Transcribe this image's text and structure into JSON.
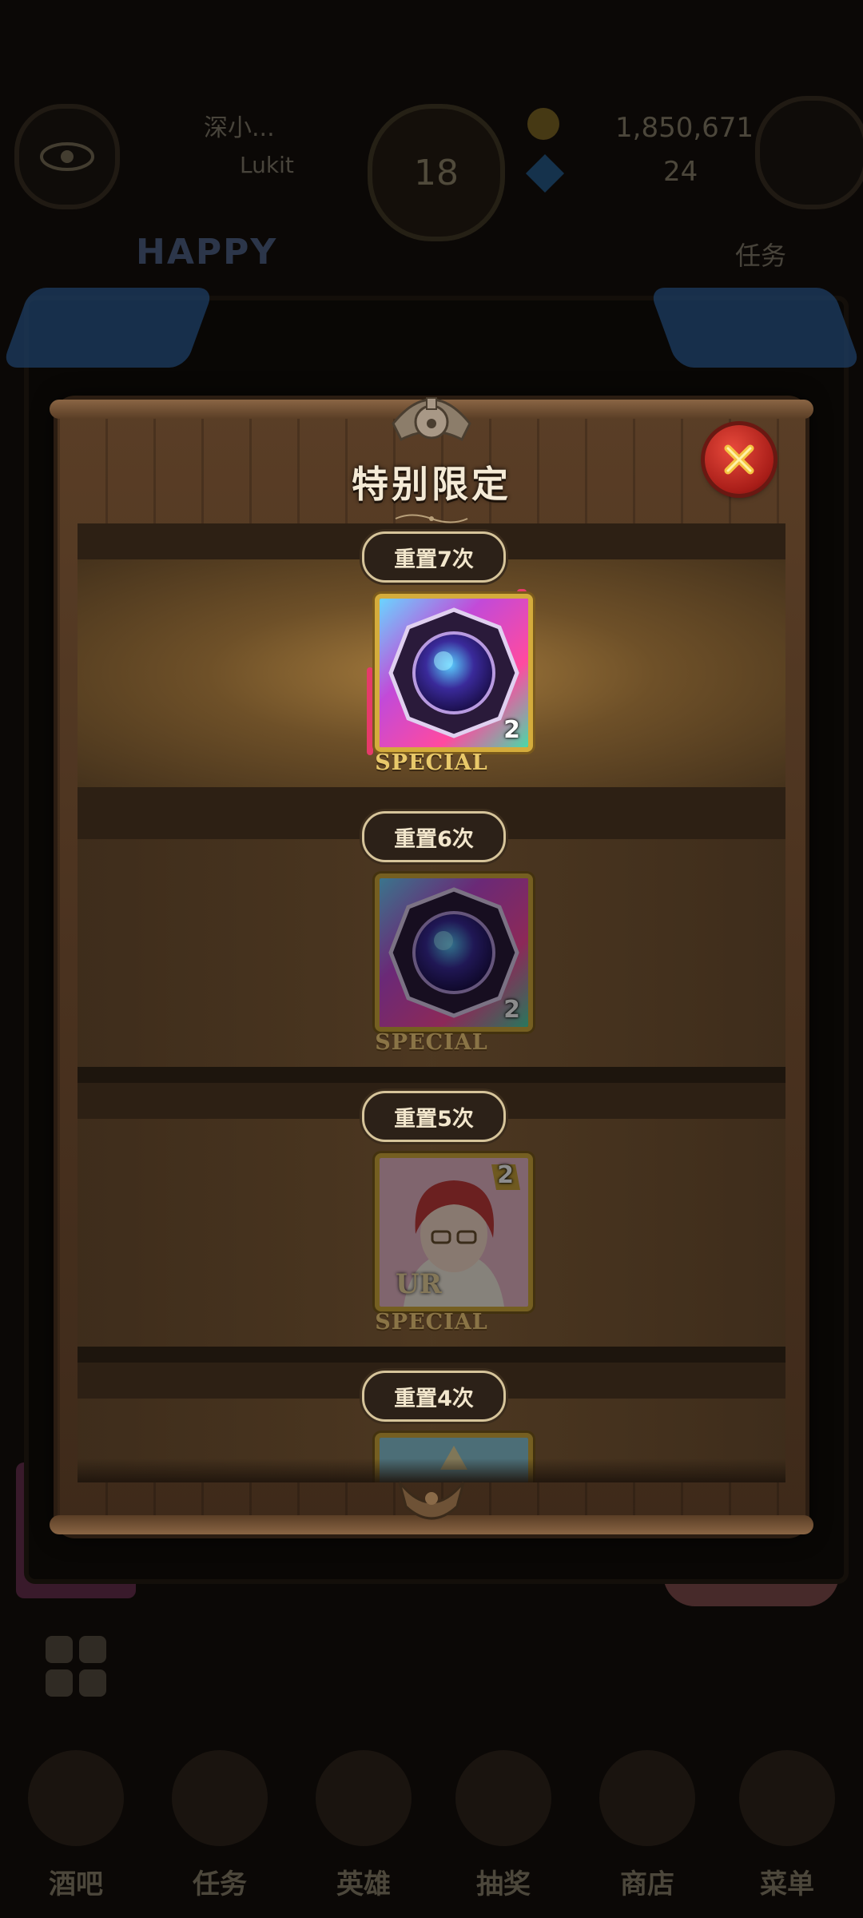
{
  "background": {
    "player_name": "深小...",
    "player_sub": "Lukit",
    "level": "18",
    "gold": "1,850,671",
    "gems": "24",
    "banner": "HAPPY",
    "task_label": "任务",
    "nav": [
      {
        "label": "酒吧"
      },
      {
        "label": "任务"
      },
      {
        "label": "英雄"
      },
      {
        "label": "抽奖"
      },
      {
        "label": "商店"
      },
      {
        "label": "菜单"
      }
    ]
  },
  "modal": {
    "title": "特别限定",
    "rows": [
      {
        "reset_label": "重置7次",
        "item": "bag-of-time",
        "count": "2",
        "tag": "SPECIAL",
        "state": "current"
      },
      {
        "reset_label": "重置6次",
        "item": "bag-of-time",
        "count": "2",
        "tag": "SPECIAL",
        "state": "locked"
      },
      {
        "reset_label": "重置5次",
        "item": "hero-card",
        "count": "2",
        "rarity": "UR",
        "tag": "SPECIAL",
        "state": "locked"
      },
      {
        "reset_label": "重置4次",
        "item": "partial-card",
        "state": "locked"
      }
    ]
  },
  "colors": {
    "accent_gold": "#d4ac3c",
    "close_red": "#a81d18",
    "special_text": "#e9c96a"
  }
}
